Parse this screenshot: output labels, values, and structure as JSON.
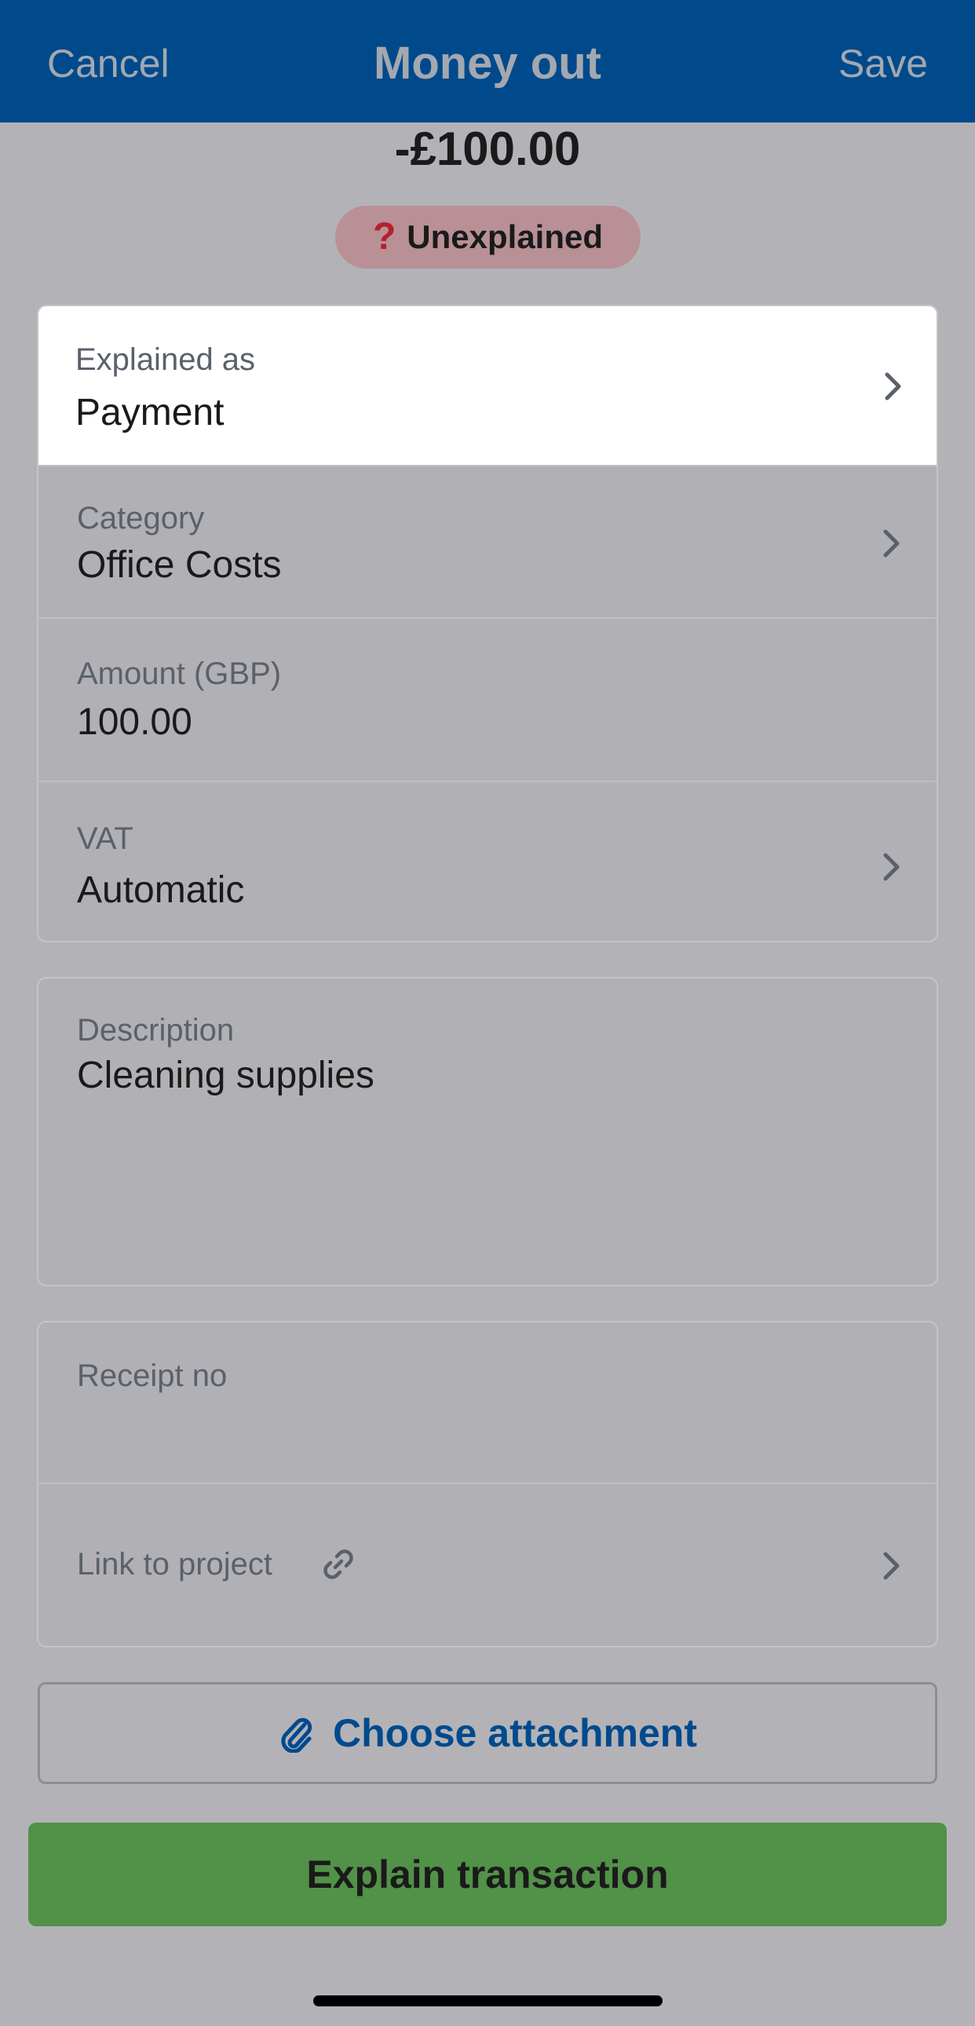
{
  "nav": {
    "cancel_label": "Cancel",
    "title": "Money out",
    "save_label": "Save"
  },
  "transaction": {
    "amount": "-£100.00",
    "status": "Unexplained",
    "status_icon": "question-mark-icon"
  },
  "fields": {
    "explained_as": {
      "label": "Explained as",
      "value": "Payment"
    },
    "category": {
      "label": "Category",
      "value": "Office Costs"
    },
    "amount": {
      "label": "Amount (GBP)",
      "value": "100.00"
    },
    "vat": {
      "label": "VAT",
      "value": "Automatic"
    },
    "description": {
      "label": "Description",
      "value": "Cleaning supplies"
    },
    "receipt_no": {
      "label": "Receipt no",
      "value": ""
    },
    "link_to_project": {
      "label": "Link to project",
      "icon": "link-icon"
    }
  },
  "buttons": {
    "choose_attachment": "Choose attachment",
    "explain_transaction": "Explain transaction"
  },
  "colors": {
    "nav_background": "#004a8c",
    "badge_background": "#b89096",
    "badge_icon": "#b4202e",
    "primary_button": "#529148",
    "link_text": "#004a8c"
  }
}
